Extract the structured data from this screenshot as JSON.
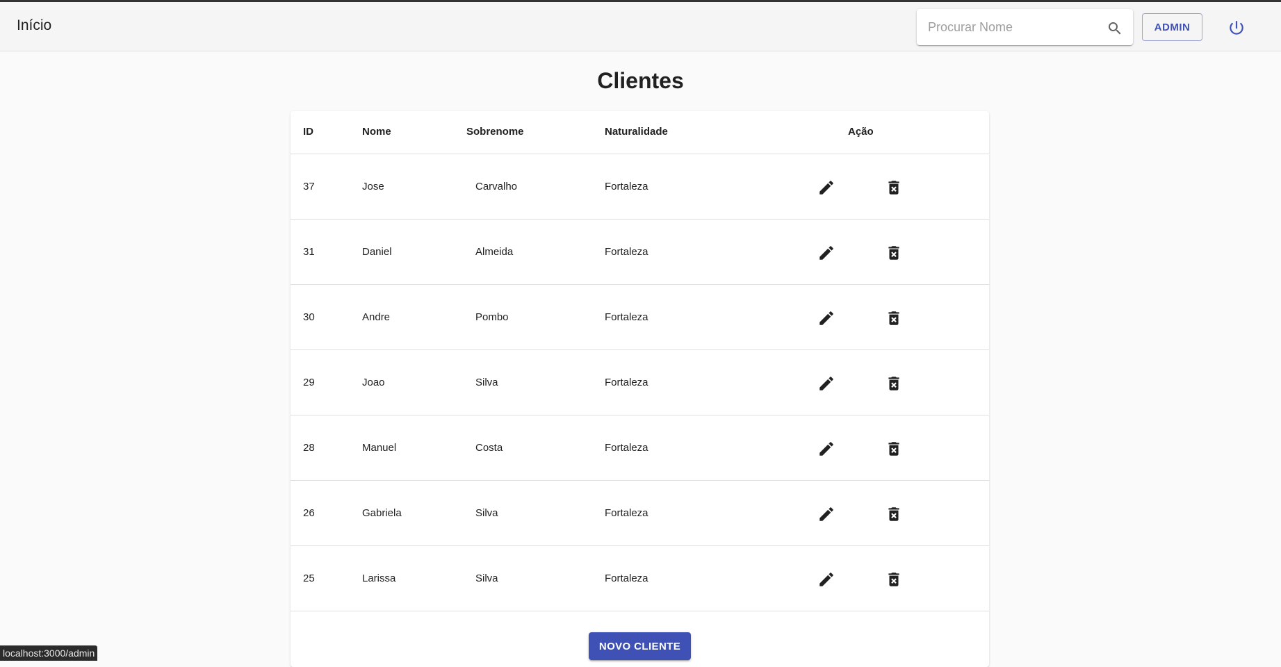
{
  "appbar": {
    "title": "Início",
    "search_placeholder": "Procurar Nome",
    "search_value": "",
    "admin_label": "ADMIN"
  },
  "page": {
    "title": "Clientes"
  },
  "table": {
    "headers": {
      "id": "ID",
      "nome": "Nome",
      "sobrenome": "Sobrenome",
      "naturalidade": "Naturalidade",
      "acao": "Ação"
    },
    "rows": [
      {
        "id": "37",
        "nome": "Jose",
        "sobrenome": "Carvalho",
        "naturalidade": "Fortaleza"
      },
      {
        "id": "31",
        "nome": "Daniel",
        "sobrenome": "Almeida",
        "naturalidade": "Fortaleza"
      },
      {
        "id": "30",
        "nome": "Andre",
        "sobrenome": "Pombo",
        "naturalidade": "Fortaleza"
      },
      {
        "id": "29",
        "nome": "Joao",
        "sobrenome": "Silva",
        "naturalidade": "Fortaleza"
      },
      {
        "id": "28",
        "nome": "Manuel",
        "sobrenome": "Costa",
        "naturalidade": "Fortaleza"
      },
      {
        "id": "26",
        "nome": "Gabriela",
        "sobrenome": "Silva",
        "naturalidade": "Fortaleza"
      },
      {
        "id": "25",
        "nome": "Larissa",
        "sobrenome": "Silva",
        "naturalidade": "Fortaleza"
      }
    ],
    "row_icons": {
      "edit": "pencil-icon",
      "delete": "delete-forever-icon"
    }
  },
  "footer": {
    "new_button_label": "NOVO CLIENTE"
  },
  "status_bar": {
    "url": "localhost:3000/admin"
  },
  "colors": {
    "primary": "#3f51b5",
    "appbar_bg": "#f5f5f5",
    "page_bg": "#fafafa"
  }
}
